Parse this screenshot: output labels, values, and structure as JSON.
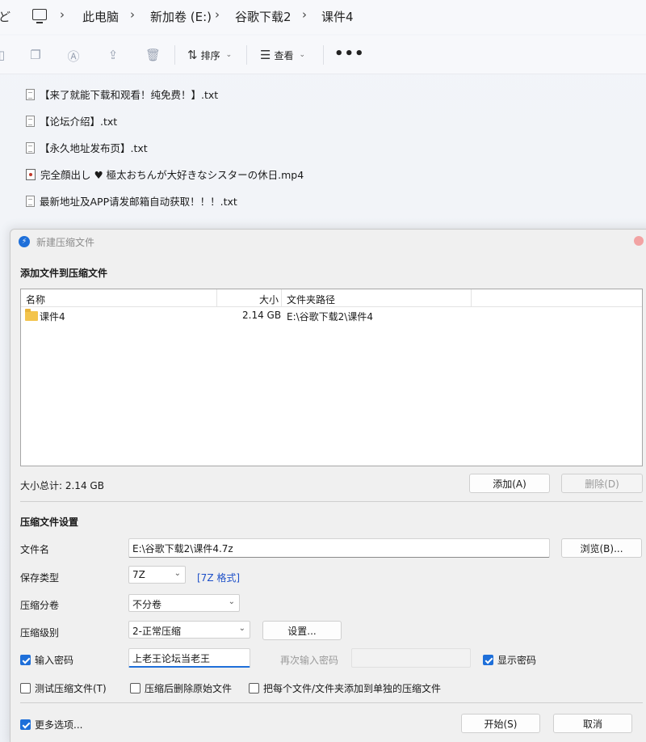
{
  "explorer": {
    "breadcrumbs": [
      "此电脑",
      "新加卷 (E:)",
      "谷歌下载2",
      "课件4"
    ],
    "toolbar": {
      "sort_label": "排序",
      "view_label": "查看",
      "more_label": "•••"
    },
    "files": [
      {
        "name": "【来了就能下载和观看！纯免费！】.txt",
        "icon": "text-file-icon"
      },
      {
        "name": "【论坛介绍】.txt",
        "icon": "text-file-icon"
      },
      {
        "name": "【永久地址发布页】.txt",
        "icon": "text-file-icon"
      },
      {
        "name": "完全顔出し ♥ 極太おちんが大好きなシスターの休日.mp4",
        "icon": "video-file-icon"
      },
      {
        "name": "最新地址及APP请发邮箱自动获取！！！.txt",
        "icon": "text-file-icon"
      }
    ]
  },
  "dialog": {
    "title": "新建压缩文件",
    "add_section_title": "添加文件到压缩文件",
    "columns": {
      "name": "名称",
      "size": "大小",
      "path": "文件夹路径"
    },
    "rows": [
      {
        "name": "课件4",
        "size": "2.14 GB",
        "path": "E:\\谷歌下载2\\课件4"
      }
    ],
    "total_size": "大小总计: 2.14 GB",
    "add_button": "添加(A)",
    "delete_button": "删除(D)",
    "settings_section_title": "压缩文件设置",
    "filename_label": "文件名",
    "filename_value": "E:\\谷歌下载2\\课件4.7z",
    "browse_button": "浏览(B)...",
    "save_type_label": "保存类型",
    "save_type_value": "7Z",
    "format_link": "[7Z 格式]",
    "split_label": "压缩分卷",
    "split_value": "不分卷",
    "level_label": "压缩级别",
    "level_value": "2-正常压缩",
    "settings_button": "设置...",
    "password_checkbox": "输入密码",
    "password_value": "上老王论坛当老王",
    "reenter_label": "再次输入密码",
    "show_password": "显示密码",
    "test_archive": "测试压缩文件(T)",
    "delete_after": "压缩后删除原始文件",
    "separate_archives": "把每个文件/文件夹添加到单独的压缩文件",
    "more_options": "更多选项...",
    "start_button": "开始(S)",
    "cancel_button": "取消",
    "accent_color": "#1e6fd9"
  }
}
